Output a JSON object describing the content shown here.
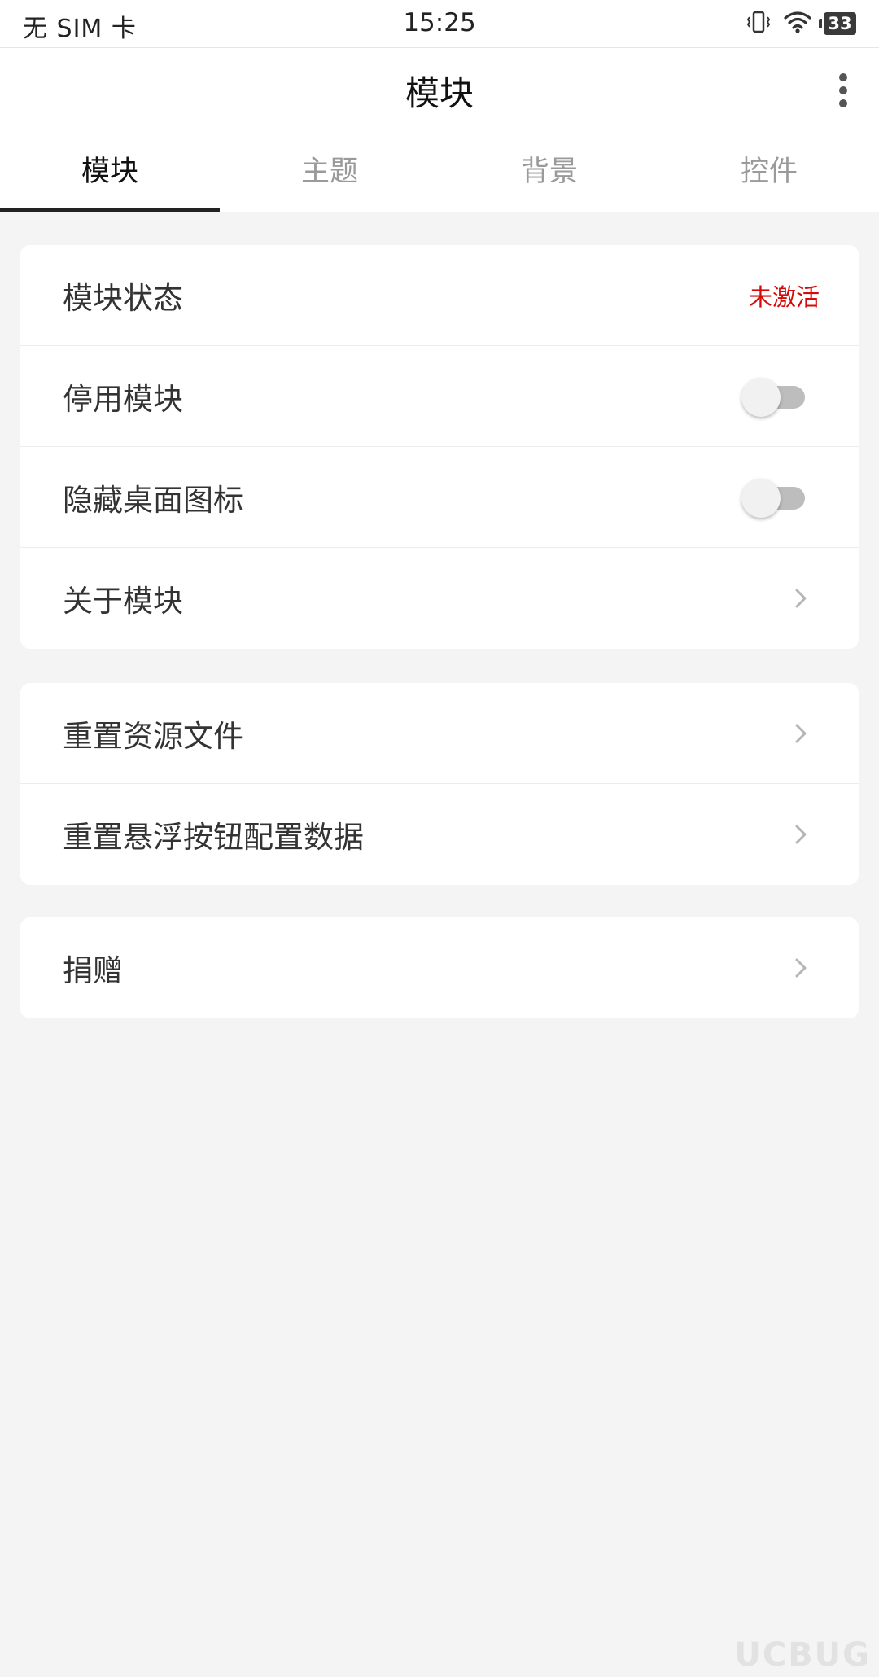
{
  "status_bar": {
    "carrier": "无 SIM 卡",
    "time": "15:25",
    "battery": "33",
    "icons": [
      "vibrate-icon",
      "wifi-icon",
      "battery-icon"
    ]
  },
  "app_bar": {
    "title": "模块",
    "menu_icon": "more-vert-icon"
  },
  "tabs": [
    {
      "label": "模块",
      "active": true
    },
    {
      "label": "主题",
      "active": false
    },
    {
      "label": "背景",
      "active": false
    },
    {
      "label": "控件",
      "active": false
    }
  ],
  "cards": [
    {
      "rows": [
        {
          "label": "模块状态",
          "value": "未激活",
          "type": "status"
        },
        {
          "label": "停用模块",
          "type": "toggle",
          "on": false
        },
        {
          "label": "隐藏桌面图标",
          "type": "toggle",
          "on": false
        },
        {
          "label": "关于模块",
          "type": "link"
        }
      ]
    },
    {
      "rows": [
        {
          "label": "重置资源文件",
          "type": "link"
        },
        {
          "label": "重置悬浮按钮配置数据",
          "type": "link"
        }
      ]
    },
    {
      "rows": [
        {
          "label": "捐赠",
          "type": "link"
        }
      ]
    }
  ],
  "colors": {
    "status_inactive": "#d50b0b",
    "tab_indicator": "#222222",
    "background": "#f4f4f4"
  },
  "watermark": "UCBUG"
}
